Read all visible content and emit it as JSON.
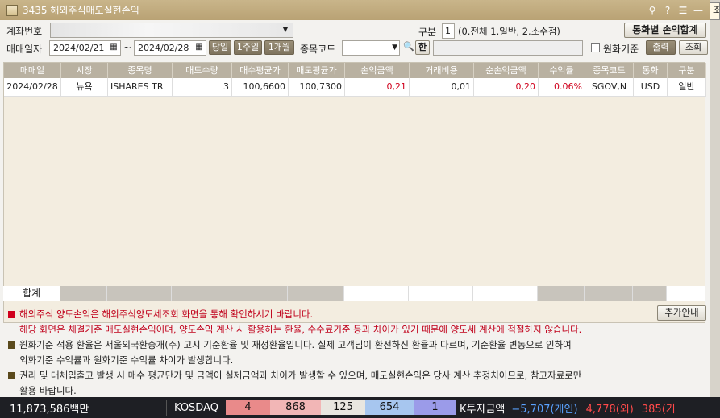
{
  "window": {
    "title": "3435 해외주식매도실현손익",
    "controls": [
      "⚲",
      "?",
      "☰",
      "—"
    ]
  },
  "right_edge": {
    "fragment": "조"
  },
  "filters": {
    "account_label": "계좌번호",
    "account_value": "",
    "type_label": "구분",
    "type_value": "1",
    "type_hint": "(0.전체 1.일반, 2.소수점)",
    "currency_total_button": "통화별 손익합계",
    "date_label": "매매일자",
    "date_from": "2024/02/21",
    "date_to": "2024/02/28",
    "tilde": "~",
    "btn_today": "당일",
    "btn_1week": "1주일",
    "btn_1month": "1개월",
    "code_label": "종목코드",
    "code_value": "",
    "code_search": "🔍",
    "code_han": "한",
    "krw_basis_label": "원화기준",
    "btn_print": "출력",
    "btn_query": "조회"
  },
  "table": {
    "headers": [
      "매매일",
      "시장",
      "종목명",
      "매도수량",
      "매수평균가",
      "매도평균가",
      "손익금액",
      "거래비용",
      "순손익금액",
      "수익률",
      "종목코드",
      "통화",
      "구분"
    ],
    "rows": [
      [
        "2024/02/28",
        "뉴욕",
        "ISHARES TR",
        "3",
        "100,6600",
        "100,7300",
        "0,21",
        "0,01",
        "0,20",
        "0.06%",
        "SGOV,N",
        "USD",
        "일반"
      ]
    ],
    "total_label": "합계"
  },
  "notes": {
    "more_button": "추가안내",
    "items": [
      {
        "marker_color": "#d0001c",
        "lines": [
          "해외주식 양도손익은 해외주식양도세조회 화면을 통해 확인하시기 바랍니다.",
          "해당 화면은 체결기준 매도실현손익이며, 양도손익 계산 시 활용하는 환율, 수수료기준 등과 차이가 있기 때문에 양도세 계산에 적절하지 않습니다."
        ],
        "red": true
      },
      {
        "marker_color": "#5a4a1c",
        "lines": [
          "원화기준 적용 환율은 서울외국환중개(주) 고시 기준환율 및 재정환율입니다. 실제 고객님이 환전하신 환율과 다르며, 기준환율 변동으로 인하여",
          "외화기준 수익률과 원화기준 수익률 차이가 발생합니다."
        ],
        "red": false
      },
      {
        "marker_color": "#5a4a1c",
        "lines": [
          "권리 및 대체입출고 발생 시 매수 평균단가 및 금액이 실제금액과 차이가 발생할  수 있으며, 매도실현손익은 당사 계산 추정치이므로, 참고자료로만",
          "활용 바랍니다."
        ],
        "red": false
      }
    ]
  },
  "statusbar": {
    "balance": "11,873,586백만",
    "market": "KOSDAQ",
    "bars": [
      {
        "value": "4",
        "color": "#e98a8a"
      },
      {
        "value": "868",
        "color": "#f2b6b6"
      },
      {
        "value": "125",
        "color": "#e9e6e0"
      },
      {
        "value": "654",
        "color": "#a7c6ef"
      },
      {
        "value": "1",
        "color": "#9b9be9"
      }
    ],
    "k_invest_label": "K투자금액",
    "individual": "−5,707(개인)",
    "foreign": "4,778(외)",
    "institution_partial": "385(기"
  }
}
